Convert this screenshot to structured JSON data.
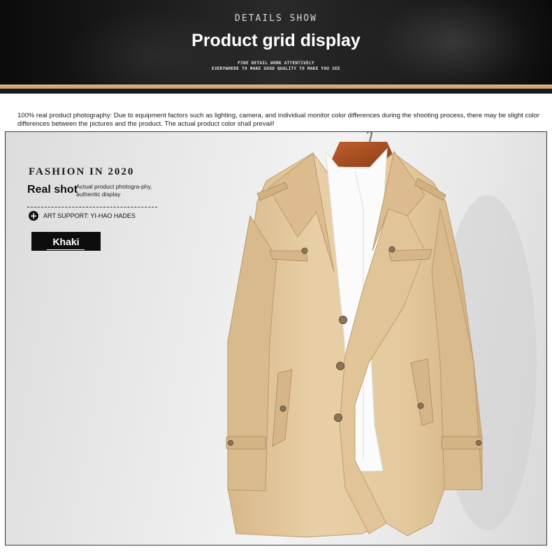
{
  "banner": {
    "kicker": "DETAILS SHOW",
    "title": "Product grid display",
    "sub_line1": "FINE DETAIL WORK ATTENTIVELY",
    "sub_line2": "EVERYWHERE TO MAKE GOOD QUALITY TO MAKE YOU SEE"
  },
  "disclaimer": "100% real product photography: Due to equipment factors such as lighting, camera, and individual monitor color differences during the shooting process, there may be slight color differences between the pictures and the product. The actual product color shall prevail!",
  "panel": {
    "fashion_label": "FASHION IN 2020",
    "real_shot_label": "Real shot",
    "real_shot_desc": "Actual product photogra-phy, authentic display",
    "support_text": "ART SUPPORT: YI-HAO HADES",
    "color_name": "Khaki"
  },
  "colors": {
    "banner_bg": "#111111",
    "accent_stripe": "#d4a874",
    "coat": "#e3c89e",
    "tag_bg": "#0d0d0d"
  }
}
